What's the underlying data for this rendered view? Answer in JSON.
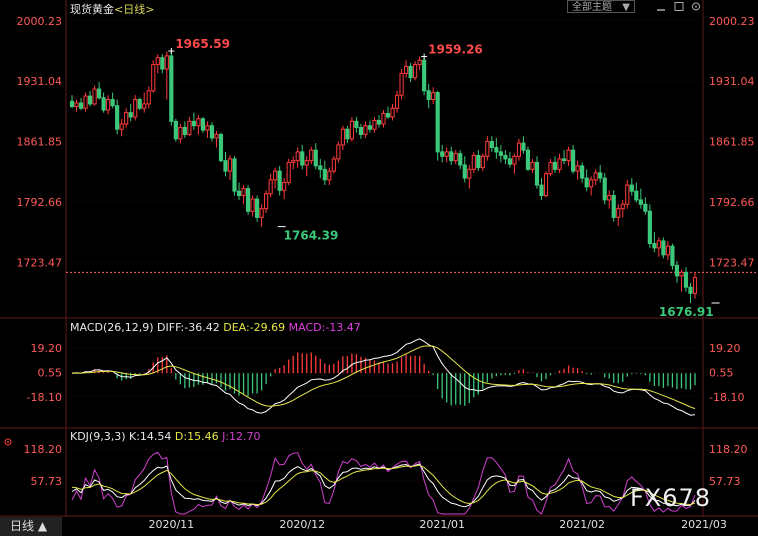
{
  "header": {
    "instrument": "现货黄金",
    "period": "<日线>",
    "theme_dropdown": "全部主题"
  },
  "bottom": {
    "period_button": "日线 ▲"
  },
  "watermark": "FX678",
  "colors": {
    "up": "#ff3b3b",
    "down": "#3cc87a",
    "axis_text_up": "#ff5a5a",
    "diff_line": "#ffffff",
    "dea_line": "#e6e64a",
    "macd_label": "#e040e0",
    "kdj_k": "#ffffff",
    "kdj_d": "#e6e64a",
    "kdj_j": "#d040d0",
    "grid": "#3a0e0e"
  },
  "chart_data": [
    {
      "type": "candlestick",
      "y_ticks": [
        "2000.23",
        "1931.04",
        "1861.85",
        "1792.66",
        "1723.47"
      ],
      "ylim": [
        1662.0,
        2008.0
      ],
      "current_price_line": 1712.0,
      "annotations": [
        {
          "text": "1965.59",
          "value": 1965.59,
          "index": 22,
          "color": "up"
        },
        {
          "text": "1764.39",
          "value": 1764.39,
          "index": 46,
          "color": "down"
        },
        {
          "text": "1959.26",
          "value": 1959.26,
          "index": 78,
          "color": "up"
        },
        {
          "text": "1676.91",
          "value": 1676.91,
          "index": 143,
          "color": "down"
        }
      ],
      "x_labels": [
        {
          "text": "2020/11",
          "index": 22
        },
        {
          "text": "2020/12",
          "index": 51
        },
        {
          "text": "2021/01",
          "index": 82
        },
        {
          "text": "2021/02",
          "index": 113
        },
        {
          "text": "2021/03",
          "index": 140
        }
      ],
      "ohlc": [
        [
          1908,
          1915,
          1900,
          1902
        ],
        [
          1902,
          1910,
          1896,
          1906
        ],
        [
          1906,
          1912,
          1898,
          1900
        ],
        [
          1900,
          1918,
          1896,
          1914
        ],
        [
          1914,
          1920,
          1902,
          1905
        ],
        [
          1905,
          1926,
          1903,
          1922
        ],
        [
          1922,
          1930,
          1910,
          1912
        ],
        [
          1912,
          1918,
          1895,
          1898
        ],
        [
          1898,
          1915,
          1893,
          1910
        ],
        [
          1910,
          1918,
          1900,
          1903
        ],
        [
          1903,
          1910,
          1870,
          1876
        ],
        [
          1876,
          1888,
          1868,
          1882
        ],
        [
          1882,
          1900,
          1878,
          1895
        ],
        [
          1895,
          1905,
          1885,
          1890
        ],
        [
          1890,
          1915,
          1886,
          1910
        ],
        [
          1910,
          1912,
          1898,
          1900
        ],
        [
          1900,
          1918,
          1895,
          1905
        ],
        [
          1905,
          1925,
          1900,
          1920
        ],
        [
          1920,
          1955,
          1918,
          1950
        ],
        [
          1950,
          1962,
          1940,
          1958
        ],
        [
          1958,
          1962,
          1940,
          1945
        ],
        [
          1945,
          1965,
          1910,
          1960
        ],
        [
          1960,
          1965.59,
          1880,
          1885
        ],
        [
          1885,
          1888,
          1862,
          1865
        ],
        [
          1865,
          1882,
          1860,
          1878
        ],
        [
          1878,
          1885,
          1866,
          1870
        ],
        [
          1870,
          1890,
          1868,
          1885
        ],
        [
          1885,
          1895,
          1875,
          1880
        ],
        [
          1880,
          1892,
          1870,
          1888
        ],
        [
          1888,
          1890,
          1872,
          1875
        ],
        [
          1875,
          1885,
          1866,
          1880
        ],
        [
          1880,
          1884,
          1862,
          1866
        ],
        [
          1866,
          1874,
          1855,
          1870
        ],
        [
          1870,
          1872,
          1838,
          1840
        ],
        [
          1840,
          1850,
          1822,
          1828
        ],
        [
          1828,
          1846,
          1818,
          1842
        ],
        [
          1842,
          1845,
          1800,
          1805
        ],
        [
          1805,
          1815,
          1795,
          1800
        ],
        [
          1800,
          1812,
          1790,
          1808
        ],
        [
          1808,
          1812,
          1778,
          1782
        ],
        [
          1782,
          1800,
          1776,
          1796
        ],
        [
          1796,
          1800,
          1770,
          1775
        ],
        [
          1775,
          1790,
          1764.39,
          1785
        ],
        [
          1785,
          1806,
          1780,
          1802
        ],
        [
          1802,
          1825,
          1798,
          1818
        ],
        [
          1818,
          1832,
          1808,
          1828
        ],
        [
          1828,
          1834,
          1800,
          1806
        ],
        [
          1806,
          1820,
          1796,
          1815
        ],
        [
          1815,
          1842,
          1812,
          1838
        ],
        [
          1838,
          1845,
          1830,
          1840
        ],
        [
          1840,
          1855,
          1832,
          1850
        ],
        [
          1850,
          1858,
          1830,
          1835
        ],
        [
          1835,
          1845,
          1822,
          1840
        ],
        [
          1840,
          1856,
          1836,
          1852
        ],
        [
          1852,
          1860,
          1830,
          1834
        ],
        [
          1834,
          1842,
          1820,
          1830
        ],
        [
          1830,
          1840,
          1812,
          1818
        ],
        [
          1818,
          1832,
          1812,
          1828
        ],
        [
          1828,
          1845,
          1825,
          1842
        ],
        [
          1842,
          1862,
          1838,
          1858
        ],
        [
          1858,
          1880,
          1852,
          1876
        ],
        [
          1876,
          1880,
          1860,
          1865
        ],
        [
          1865,
          1890,
          1862,
          1885
        ],
        [
          1885,
          1890,
          1872,
          1878
        ],
        [
          1878,
          1882,
          1865,
          1870
        ],
        [
          1870,
          1885,
          1866,
          1880
        ],
        [
          1880,
          1886,
          1872,
          1876
        ],
        [
          1876,
          1890,
          1872,
          1886
        ],
        [
          1886,
          1892,
          1878,
          1882
        ],
        [
          1882,
          1898,
          1878,
          1894
        ],
        [
          1894,
          1902,
          1888,
          1890
        ],
        [
          1890,
          1905,
          1886,
          1900
        ],
        [
          1900,
          1920,
          1895,
          1915
        ],
        [
          1915,
          1945,
          1910,
          1940
        ],
        [
          1940,
          1955,
          1935,
          1948
        ],
        [
          1948,
          1952,
          1930,
          1935
        ],
        [
          1935,
          1954,
          1932,
          1950
        ],
        [
          1950,
          1959.26,
          1944,
          1955
        ],
        [
          1955,
          1958,
          1915,
          1920
        ],
        [
          1920,
          1928,
          1900,
          1910
        ],
        [
          1910,
          1924,
          1905,
          1918
        ],
        [
          1918,
          1920,
          1840,
          1850
        ],
        [
          1850,
          1858,
          1838,
          1845
        ],
        [
          1845,
          1855,
          1838,
          1850
        ],
        [
          1850,
          1856,
          1835,
          1840
        ],
        [
          1840,
          1852,
          1836,
          1848
        ],
        [
          1848,
          1852,
          1830,
          1835
        ],
        [
          1835,
          1845,
          1815,
          1820
        ],
        [
          1820,
          1835,
          1808,
          1830
        ],
        [
          1830,
          1850,
          1826,
          1846
        ],
        [
          1846,
          1852,
          1828,
          1832
        ],
        [
          1832,
          1848,
          1828,
          1845
        ],
        [
          1845,
          1868,
          1840,
          1862
        ],
        [
          1862,
          1868,
          1850,
          1855
        ],
        [
          1855,
          1866,
          1842,
          1850
        ],
        [
          1850,
          1858,
          1838,
          1846
        ],
        [
          1846,
          1852,
          1836,
          1842
        ],
        [
          1842,
          1850,
          1832,
          1836
        ],
        [
          1836,
          1848,
          1825,
          1845
        ],
        [
          1845,
          1865,
          1840,
          1860
        ],
        [
          1860,
          1868,
          1848,
          1852
        ],
        [
          1852,
          1856,
          1828,
          1830
        ],
        [
          1830,
          1842,
          1826,
          1838
        ],
        [
          1838,
          1845,
          1808,
          1812
        ],
        [
          1812,
          1820,
          1795,
          1800
        ],
        [
          1800,
          1828,
          1798,
          1825
        ],
        [
          1825,
          1842,
          1822,
          1838
        ],
        [
          1838,
          1845,
          1826,
          1830
        ],
        [
          1830,
          1848,
          1826,
          1842
        ],
        [
          1842,
          1852,
          1836,
          1840
        ],
        [
          1840,
          1856,
          1834,
          1852
        ],
        [
          1852,
          1858,
          1825,
          1828
        ],
        [
          1828,
          1840,
          1818,
          1834
        ],
        [
          1834,
          1838,
          1815,
          1820
        ],
        [
          1820,
          1830,
          1805,
          1810
        ],
        [
          1810,
          1822,
          1800,
          1818
        ],
        [
          1818,
          1830,
          1812,
          1826
        ],
        [
          1826,
          1835,
          1815,
          1820
        ],
        [
          1820,
          1826,
          1790,
          1795
        ],
        [
          1795,
          1806,
          1785,
          1800
        ],
        [
          1800,
          1806,
          1770,
          1775
        ],
        [
          1775,
          1790,
          1765,
          1785
        ],
        [
          1785,
          1795,
          1775,
          1790
        ],
        [
          1790,
          1818,
          1785,
          1812
        ],
        [
          1812,
          1820,
          1800,
          1805
        ],
        [
          1805,
          1815,
          1792,
          1795
        ],
        [
          1795,
          1808,
          1785,
          1790
        ],
        [
          1790,
          1798,
          1778,
          1782
        ],
        [
          1782,
          1790,
          1740,
          1745
        ],
        [
          1745,
          1758,
          1735,
          1740
        ],
        [
          1740,
          1752,
          1730,
          1748
        ],
        [
          1748,
          1752,
          1728,
          1732
        ],
        [
          1732,
          1748,
          1726,
          1742
        ],
        [
          1742,
          1745,
          1715,
          1720
        ],
        [
          1720,
          1725,
          1700,
          1708
        ],
        [
          1708,
          1715,
          1690,
          1712
        ],
        [
          1712,
          1718,
          1690,
          1695
        ],
        [
          1695,
          1700,
          1676.91,
          1688
        ],
        [
          1688,
          1712,
          1682,
          1706
        ]
      ]
    },
    {
      "type": "macd",
      "params": "MACD(26,12,9)",
      "labels": {
        "diff": "DIFF:-36.42",
        "dea": "DEA:-29.69",
        "macd": "MACD:-13.47"
      },
      "y_ticks": [
        "19.20",
        "0.55",
        "-18.10"
      ],
      "ylim": [
        -42,
        30
      ]
    },
    {
      "type": "kdj",
      "params": "KDJ(9,3,3)",
      "labels": {
        "k": "K:14.54",
        "d": "D:15.46",
        "j": "J:12.70"
      },
      "y_ticks": [
        "118.20",
        "57.73"
      ],
      "ylim": [
        -5,
        130
      ]
    }
  ]
}
